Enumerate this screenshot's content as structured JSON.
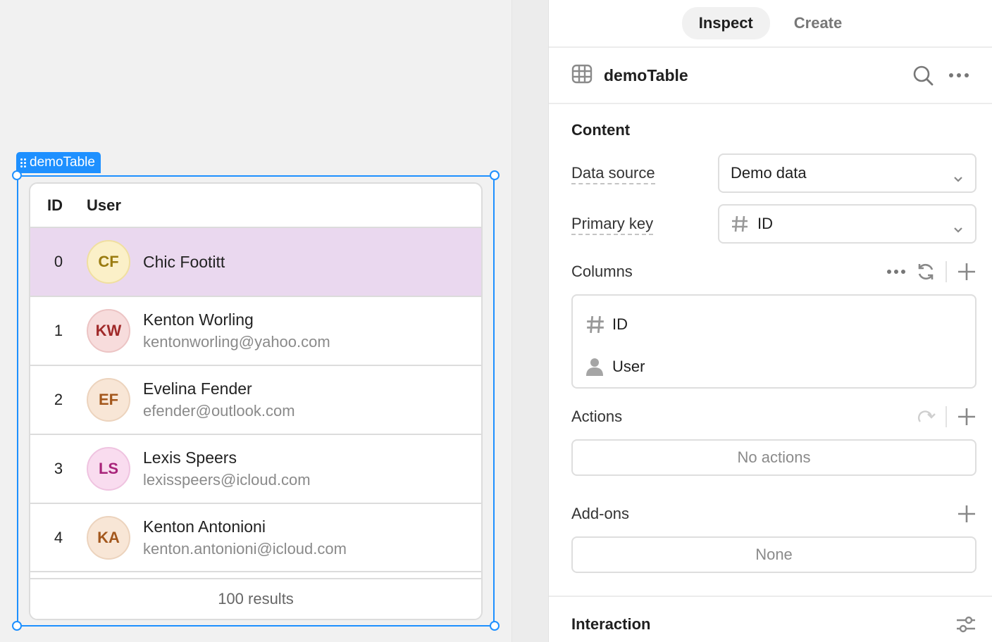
{
  "canvas": {
    "selection_label": "demoTable",
    "table": {
      "headers": {
        "id": "ID",
        "user": "User"
      },
      "rows": [
        {
          "id": "0",
          "initials": "CF",
          "name": "Chic Footitt",
          "email": "",
          "avatar_bg": "#fbf0c8",
          "avatar_fg": "#9a7b10",
          "selected": true
        },
        {
          "id": "1",
          "initials": "KW",
          "name": "Kenton Worling",
          "email": "kentonworling@yahoo.com",
          "avatar_bg": "#f7dcdc",
          "avatar_fg": "#a02a2a"
        },
        {
          "id": "2",
          "initials": "EF",
          "name": "Evelina Fender",
          "email": "efender@outlook.com",
          "avatar_bg": "#f8e6d6",
          "avatar_fg": "#a3571c"
        },
        {
          "id": "3",
          "initials": "LS",
          "name": "Lexis Speers",
          "email": "lexisspeers@icloud.com",
          "avatar_bg": "#f9dcef",
          "avatar_fg": "#a8247a"
        },
        {
          "id": "4",
          "initials": "KA",
          "name": "Kenton Antonioni",
          "email": "kenton.antonioni@icloud.com",
          "avatar_bg": "#f8e6d6",
          "avatar_fg": "#a3571c"
        }
      ],
      "footer": "100 results"
    }
  },
  "panel": {
    "tabs": [
      {
        "label": "Inspect",
        "active": true
      },
      {
        "label": "Create",
        "active": false
      }
    ],
    "component": {
      "name": "demoTable",
      "icon": "table-icon"
    },
    "content": {
      "title": "Content",
      "data_source": {
        "label": "Data source",
        "value": "Demo data"
      },
      "primary_key": {
        "label": "Primary key",
        "value": "ID",
        "icon": "hash-icon"
      },
      "columns": {
        "title": "Columns",
        "items": [
          {
            "label": "ID",
            "icon": "hash-icon"
          },
          {
            "label": "User",
            "icon": "user-icon"
          }
        ]
      },
      "actions": {
        "title": "Actions",
        "empty": "No actions"
      },
      "addons": {
        "title": "Add-ons",
        "empty": "None"
      }
    },
    "interaction": {
      "title": "Interaction"
    }
  },
  "colors": {
    "accent": "#1e90ff",
    "selected_row": "#ead8ef"
  }
}
